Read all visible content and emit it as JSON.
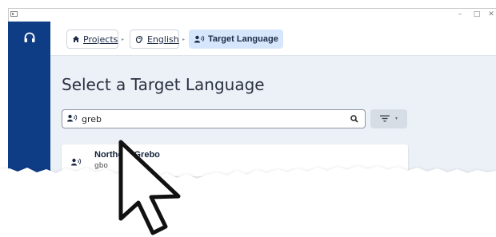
{
  "window": {
    "title": "",
    "controls": [
      "–",
      "□",
      "✕"
    ]
  },
  "sidebar": {
    "icon": "headset-icon"
  },
  "breadcrumb": {
    "items": [
      {
        "label": "Projects",
        "icon": "home-icon"
      },
      {
        "label": "English",
        "icon": "hand-ear-icon"
      },
      {
        "label": "Target Language",
        "icon": "speaker-person-icon",
        "active": true
      }
    ],
    "separator": "▸"
  },
  "main": {
    "title": "Select a Target Language",
    "search": {
      "value": "greb",
      "leading_icon": "speaker-person-icon",
      "trailing_icon": "search-icon"
    },
    "filter": {
      "icon": "filter-icon",
      "caret": "▾"
    },
    "results": [
      {
        "name": "Northern Grebo",
        "code": "gbo",
        "icon": "speaker-person-icon"
      }
    ]
  },
  "colors": {
    "sidebar": "#0e3c85",
    "background": "#ecf1f7",
    "active_crumb": "#d6e6fb",
    "text_dark": "#14233b"
  }
}
